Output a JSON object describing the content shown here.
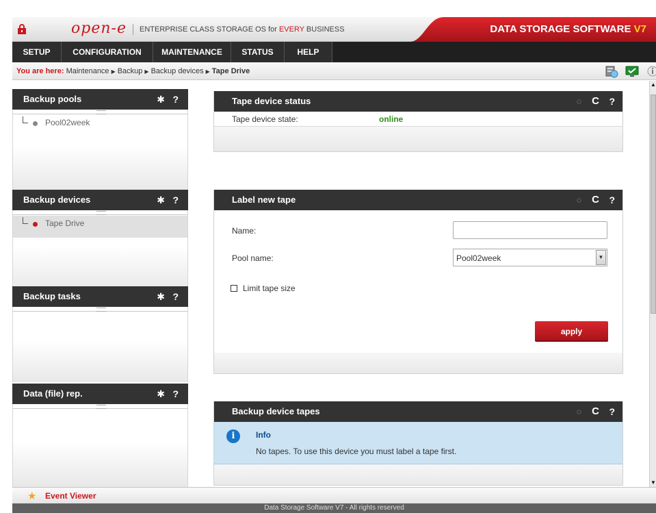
{
  "header": {
    "logo": "open-e",
    "tagline_prefix": "ENTERPRISE CLASS STORAGE OS for ",
    "tagline_highlight": "EVERY",
    "tagline_suffix": " BUSINESS",
    "product_title": "DATA STORAGE SOFTWARE ",
    "product_version": "V7"
  },
  "nav": {
    "setup": "SETUP",
    "configuration": "CONFIGURATION",
    "maintenance": "MAINTENANCE",
    "status": "STATUS",
    "help": "HELP"
  },
  "breadcrumb": {
    "label": "You are here:",
    "items": [
      "Maintenance",
      "Backup",
      "Backup devices"
    ],
    "current": "Tape Drive"
  },
  "left_panels": {
    "pools": {
      "title": "Backup pools",
      "gear": "✱",
      "help": "?",
      "items": [
        "Pool02week"
      ]
    },
    "devices": {
      "title": "Backup devices",
      "gear": "✱",
      "help": "?",
      "items": [
        "Tape Drive"
      ]
    },
    "tasks": {
      "title": "Backup tasks",
      "gear": "✱",
      "help": "?"
    },
    "data_rep": {
      "title": "Data (file) rep.",
      "gear": "✱",
      "help": "?"
    }
  },
  "tape_status": {
    "title": "Tape device status",
    "state_label": "Tape device state:",
    "state_value": "online"
  },
  "label_tape": {
    "title": "Label new tape",
    "name_label": "Name:",
    "name_value": "",
    "pool_label": "Pool name:",
    "pool_value": "Pool02week",
    "limit_label": "Limit tape size",
    "apply_label": "apply"
  },
  "tapes": {
    "title": "Backup device tapes",
    "info_title": "Info",
    "info_message": "No tapes. To use this device you must label a tape first."
  },
  "panel_icons": {
    "spinner": "◌",
    "refresh": "C",
    "help": "?"
  },
  "event_viewer": {
    "label": "Event Viewer"
  },
  "footer": {
    "text": "Data Storage Software V7 - All rights reserved"
  },
  "colors": {
    "brand_red": "#c8171e",
    "online_green": "#2f8f1f",
    "nav_dark": "#2d2d2d",
    "info_blue": "#cce3f4"
  },
  "icons": [
    "lock-icon",
    "settings-icon",
    "monitor-icon",
    "info-icon",
    "gear-icon",
    "help-icon",
    "spinner-icon",
    "refresh-icon",
    "star-icon",
    "chevron-down-icon"
  ]
}
